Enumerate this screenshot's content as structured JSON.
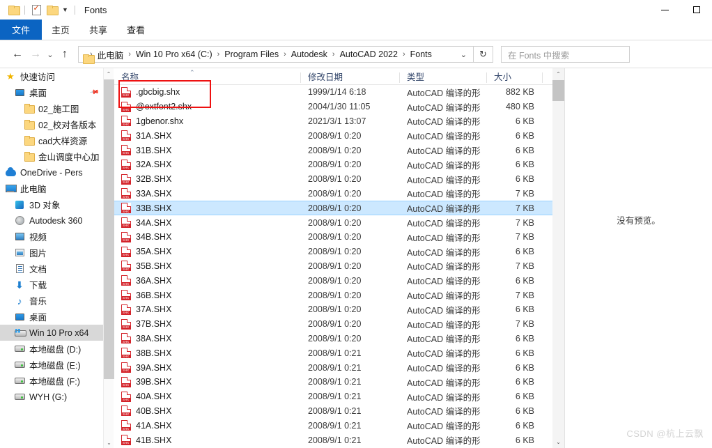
{
  "window": {
    "title": "Fonts",
    "quick_access": [
      "folder-icon",
      "properties-icon",
      "new-folder-icon",
      "customize-chevron-icon"
    ],
    "controls": {
      "minimize": "minimize-icon",
      "maximize": "maximize-icon"
    }
  },
  "ribbon": {
    "tabs": [
      {
        "label": "文件",
        "active": true
      },
      {
        "label": "主页",
        "active": false
      },
      {
        "label": "共享",
        "active": false
      },
      {
        "label": "查看",
        "active": false
      }
    ]
  },
  "nav": {
    "back": "←",
    "forward": "→",
    "history": "⌄",
    "up": "↑",
    "breadcrumbs": [
      "此电脑",
      "Win 10 Pro x64 (C:)",
      "Program Files",
      "Autodesk",
      "AutoCAD 2022",
      "Fonts"
    ],
    "crumb_separator": "›",
    "dropdown": "⌄",
    "refresh": "↻",
    "search_placeholder": "在 Fonts 中搜索"
  },
  "sidebar": {
    "items": [
      {
        "label": "快速访问",
        "icon": "star-pin-icon",
        "indent": 0,
        "selected": false
      },
      {
        "label": "桌面",
        "icon": "desktop-icon",
        "indent": 1,
        "selected": false,
        "pinned": true
      },
      {
        "label": "02_施工图",
        "icon": "folder-icon",
        "indent": 2,
        "selected": false
      },
      {
        "label": "02_校对各版本",
        "icon": "folder-icon",
        "indent": 2,
        "selected": false
      },
      {
        "label": "cad大样资源",
        "icon": "folder-icon",
        "indent": 2,
        "selected": false
      },
      {
        "label": "金山调度中心加",
        "icon": "folder-icon",
        "indent": 2,
        "selected": false
      },
      {
        "label": "OneDrive - Pers",
        "icon": "cloud-icon",
        "indent": 0,
        "selected": false
      },
      {
        "label": "此电脑",
        "icon": "this-pc-icon",
        "indent": 0,
        "selected": false
      },
      {
        "label": "3D 对象",
        "icon": "3d-objects-icon",
        "indent": 1,
        "selected": false
      },
      {
        "label": "Autodesk 360",
        "icon": "autodesk-360-icon",
        "indent": 1,
        "selected": false
      },
      {
        "label": "视频",
        "icon": "videos-icon",
        "indent": 1,
        "selected": false
      },
      {
        "label": "图片",
        "icon": "pictures-icon",
        "indent": 1,
        "selected": false
      },
      {
        "label": "文档",
        "icon": "documents-icon",
        "indent": 1,
        "selected": false
      },
      {
        "label": "下载",
        "icon": "downloads-icon",
        "indent": 1,
        "selected": false
      },
      {
        "label": "音乐",
        "icon": "music-icon",
        "indent": 1,
        "selected": false
      },
      {
        "label": "桌面",
        "icon": "desktop-icon",
        "indent": 1,
        "selected": false
      },
      {
        "label": "Win 10 Pro x64",
        "icon": "windows-drive-icon",
        "indent": 1,
        "selected": true
      },
      {
        "label": "本地磁盘 (D:)",
        "icon": "drive-icon",
        "indent": 1,
        "selected": false
      },
      {
        "label": "本地磁盘 (E:)",
        "icon": "drive-icon",
        "indent": 1,
        "selected": false
      },
      {
        "label": "本地磁盘 (F:)",
        "icon": "drive-icon",
        "indent": 1,
        "selected": false
      },
      {
        "label": "WYH (G:)",
        "icon": "drive-icon",
        "indent": 1,
        "selected": false
      }
    ]
  },
  "file_list": {
    "columns": [
      {
        "key": "name",
        "label": "名称",
        "sorted": true,
        "sort_dir": "asc"
      },
      {
        "key": "date",
        "label": "修改日期"
      },
      {
        "key": "type",
        "label": "类型"
      },
      {
        "key": "size",
        "label": "大小"
      }
    ],
    "rows": [
      {
        "name": ".gbcbig.shx",
        "date": "1999/1/14 6:18",
        "type": "AutoCAD 编译的形",
        "size": "882 KB",
        "selected": false,
        "highlighted": true
      },
      {
        "name": "@extfont2.shx",
        "date": "2004/1/30 11:05",
        "type": "AutoCAD 编译的形",
        "size": "480 KB",
        "selected": false
      },
      {
        "name": "1gbenor.shx",
        "date": "2021/3/1 13:07",
        "type": "AutoCAD 编译的形",
        "size": "6 KB",
        "selected": false
      },
      {
        "name": "31A.SHX",
        "date": "2008/9/1 0:20",
        "type": "AutoCAD 编译的形",
        "size": "6 KB",
        "selected": false
      },
      {
        "name": "31B.SHX",
        "date": "2008/9/1 0:20",
        "type": "AutoCAD 编译的形",
        "size": "6 KB",
        "selected": false
      },
      {
        "name": "32A.SHX",
        "date": "2008/9/1 0:20",
        "type": "AutoCAD 编译的形",
        "size": "6 KB",
        "selected": false
      },
      {
        "name": "32B.SHX",
        "date": "2008/9/1 0:20",
        "type": "AutoCAD 编译的形",
        "size": "6 KB",
        "selected": false
      },
      {
        "name": "33A.SHX",
        "date": "2008/9/1 0:20",
        "type": "AutoCAD 编译的形",
        "size": "7 KB",
        "selected": false
      },
      {
        "name": "33B.SHX",
        "date": "2008/9/1 0:20",
        "type": "AutoCAD 编译的形",
        "size": "7 KB",
        "selected": true
      },
      {
        "name": "34A.SHX",
        "date": "2008/9/1 0:20",
        "type": "AutoCAD 编译的形",
        "size": "7 KB",
        "selected": false
      },
      {
        "name": "34B.SHX",
        "date": "2008/9/1 0:20",
        "type": "AutoCAD 编译的形",
        "size": "7 KB",
        "selected": false
      },
      {
        "name": "35A.SHX",
        "date": "2008/9/1 0:20",
        "type": "AutoCAD 编译的形",
        "size": "6 KB",
        "selected": false
      },
      {
        "name": "35B.SHX",
        "date": "2008/9/1 0:20",
        "type": "AutoCAD 编译的形",
        "size": "7 KB",
        "selected": false
      },
      {
        "name": "36A.SHX",
        "date": "2008/9/1 0:20",
        "type": "AutoCAD 编译的形",
        "size": "6 KB",
        "selected": false
      },
      {
        "name": "36B.SHX",
        "date": "2008/9/1 0:20",
        "type": "AutoCAD 编译的形",
        "size": "7 KB",
        "selected": false
      },
      {
        "name": "37A.SHX",
        "date": "2008/9/1 0:20",
        "type": "AutoCAD 编译的形",
        "size": "6 KB",
        "selected": false
      },
      {
        "name": "37B.SHX",
        "date": "2008/9/1 0:20",
        "type": "AutoCAD 编译的形",
        "size": "7 KB",
        "selected": false
      },
      {
        "name": "38A.SHX",
        "date": "2008/9/1 0:20",
        "type": "AutoCAD 编译的形",
        "size": "6 KB",
        "selected": false
      },
      {
        "name": "38B.SHX",
        "date": "2008/9/1 0:21",
        "type": "AutoCAD 编译的形",
        "size": "6 KB",
        "selected": false
      },
      {
        "name": "39A.SHX",
        "date": "2008/9/1 0:21",
        "type": "AutoCAD 编译的形",
        "size": "6 KB",
        "selected": false
      },
      {
        "name": "39B.SHX",
        "date": "2008/9/1 0:21",
        "type": "AutoCAD 编译的形",
        "size": "6 KB",
        "selected": false
      },
      {
        "name": "40A.SHX",
        "date": "2008/9/1 0:21",
        "type": "AutoCAD 编译的形",
        "size": "6 KB",
        "selected": false
      },
      {
        "name": "40B.SHX",
        "date": "2008/9/1 0:21",
        "type": "AutoCAD 编译的形",
        "size": "6 KB",
        "selected": false
      },
      {
        "name": "41A.SHX",
        "date": "2008/9/1 0:21",
        "type": "AutoCAD 编译的形",
        "size": "6 KB",
        "selected": false
      },
      {
        "name": "41B.SHX",
        "date": "2008/9/1 0:21",
        "type": "AutoCAD 编译的形",
        "size": "6 KB",
        "selected": false
      }
    ]
  },
  "preview": {
    "text": "没有预览。"
  },
  "watermark": {
    "text": "CSDN @杭上云飘"
  },
  "colors": {
    "accent": "#0b64c2",
    "selection": "#cce8ff",
    "annotation": "#ee1111",
    "shx_icon": "#d4232a"
  }
}
